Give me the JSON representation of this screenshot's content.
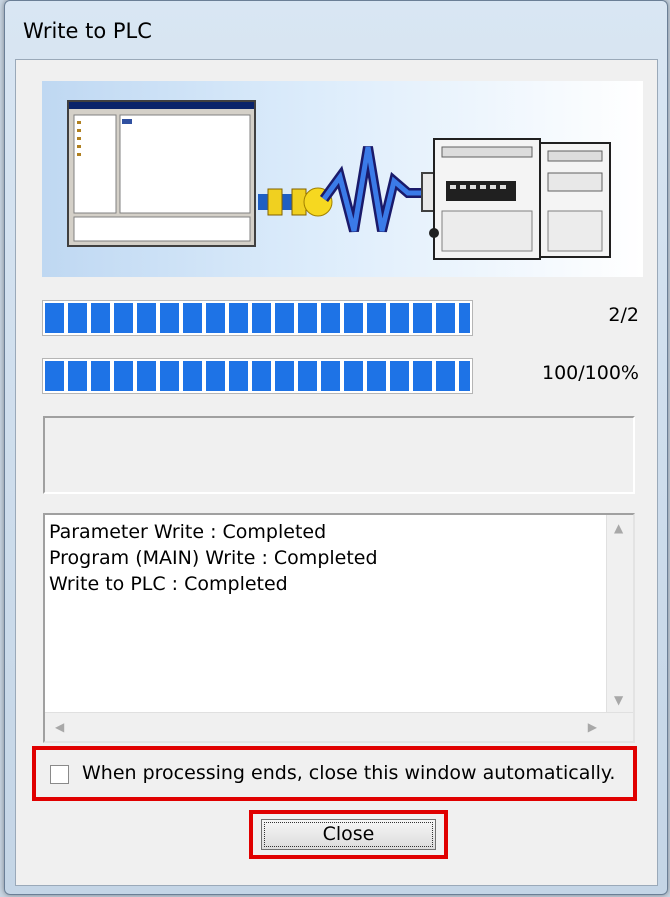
{
  "window": {
    "title": "Write to PLC"
  },
  "progress": {
    "steps": {
      "label": "2/2",
      "fraction": 1.0
    },
    "percent": {
      "label": "100/100%",
      "fraction": 1.0
    }
  },
  "status_text": "",
  "log": {
    "lines": [
      "Parameter Write : Completed",
      "Program (MAIN) Write : Completed",
      "Write to PLC : Completed"
    ]
  },
  "auto_close": {
    "label": "When processing ends, close this window automatically.",
    "checked": false
  },
  "buttons": {
    "close_label": "Close"
  },
  "colors": {
    "progress": "#1e73e6",
    "highlight": "#e00000"
  },
  "icons": {
    "banner": "pc-to-plc-transfer-illustration"
  }
}
